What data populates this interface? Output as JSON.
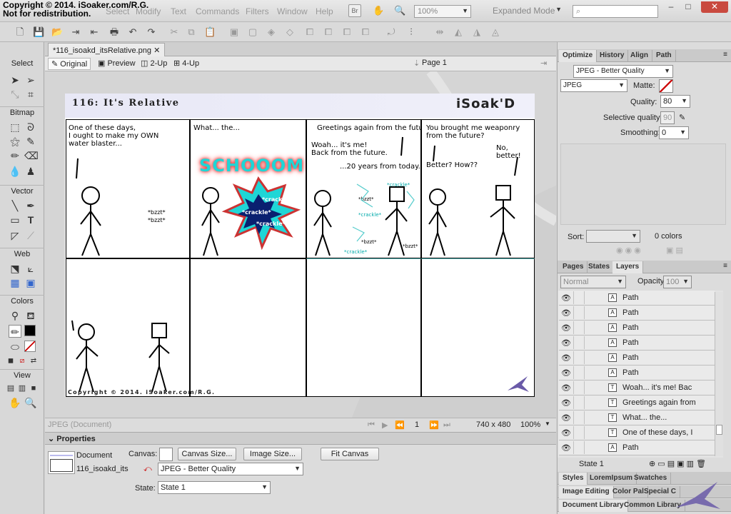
{
  "watermark": {
    "line1": "Copyright © 2014. iSoaker.com/R.G.",
    "line2": "Not for redistribution."
  },
  "menu": {
    "items": [
      "Select",
      "Modify",
      "Text",
      "Commands",
      "Filters",
      "Window",
      "Help"
    ],
    "zoom": "100%",
    "workspace": "Expanded Mode",
    "br": "Br"
  },
  "document": {
    "tab": "*116_isoakd_itsRelative.png"
  },
  "views": {
    "original": "Original",
    "preview": "Preview",
    "two_up": "2-Up",
    "four_up": "4-Up",
    "page": "Page 1"
  },
  "tools": {
    "select": "Select",
    "bitmap": "Bitmap",
    "vector": "Vector",
    "web": "Web",
    "colors": "Colors",
    "view": "View"
  },
  "comic": {
    "title": "116: It's Relative",
    "logo": "iSoak'D",
    "footer": "Copyright © 2014. iSoaker.com/R.G.",
    "p1": "One of these days,\nI ought to make my OWN\nwater blaster...",
    "p1_bzzt": "*bzzt*\n*bzzt*",
    "p2": "What... the...",
    "p2_sfx": "SCHOOOM",
    "p2_crackle": [
      "*crackle*",
      "*crackle*",
      "*crackle*"
    ],
    "p3a": "Greetings again from the future!",
    "p3b": "Woah... it's me!\nBack from the future.",
    "p3c": "...20 years from today.",
    "p3_fx": [
      "*bzzt*",
      "*crackle*",
      "*crackle*",
      "*crackle*",
      "*bzzt*",
      "*crackle*",
      "*bzzt*"
    ],
    "p4a": "You brought me weaponry\nfrom the future?",
    "p4b": "No, better!",
    "p4c": "Better? How??"
  },
  "status": {
    "mode": "JPEG (Document)",
    "frame": "1",
    "size": "740 x 480",
    "zoom": "100%"
  },
  "properties": {
    "header": "Properties",
    "doc_label": "Document",
    "doc_name": "116_isoakd_its",
    "canvas_label": "Canvas:",
    "canvas_size": "Canvas Size...",
    "image_size": "Image Size...",
    "fit_canvas": "Fit Canvas",
    "format": "JPEG - Better Quality",
    "state_label": "State:",
    "state": "State 1"
  },
  "optimize": {
    "tabs": [
      "Optimize",
      "History",
      "Align",
      "Path"
    ],
    "preset": "JPEG - Better Quality",
    "format": "JPEG",
    "matte_label": "Matte:",
    "quality_label": "Quality:",
    "quality": "80",
    "selective_label": "Selective quality:",
    "selective": "90",
    "smoothing_label": "Smoothing:",
    "smoothing": "0",
    "sort_label": "Sort:",
    "colors": "0 colors"
  },
  "layers": {
    "tabs": [
      "Pages",
      "States",
      "Layers"
    ],
    "blend": "Normal",
    "opacity_label": "Opacity",
    "opacity": "100",
    "rows": [
      {
        "name": "Path",
        "icon": "path-icon"
      },
      {
        "name": "Path",
        "icon": "path-icon"
      },
      {
        "name": "Path",
        "icon": "path-icon"
      },
      {
        "name": "Path",
        "icon": "path-icon"
      },
      {
        "name": "Path",
        "icon": "path-icon"
      },
      {
        "name": "Path",
        "icon": "path-icon"
      },
      {
        "name": "Woah... it's me! Bac",
        "icon": "text-icon"
      },
      {
        "name": "Greetings again from",
        "icon": "text-icon"
      },
      {
        "name": "What... the...",
        "icon": "text-icon"
      },
      {
        "name": "One of these days, I",
        "icon": "text-icon"
      },
      {
        "name": "Path",
        "icon": "path-icon"
      }
    ],
    "state": "State 1"
  },
  "bottom_tabs": {
    "row1": [
      "Styles",
      "LoremIpsum",
      "Swatches"
    ],
    "row2": [
      "Image Editing",
      "Color Pal",
      "Special C"
    ],
    "row3": [
      "Document Library",
      "Common Library"
    ]
  }
}
